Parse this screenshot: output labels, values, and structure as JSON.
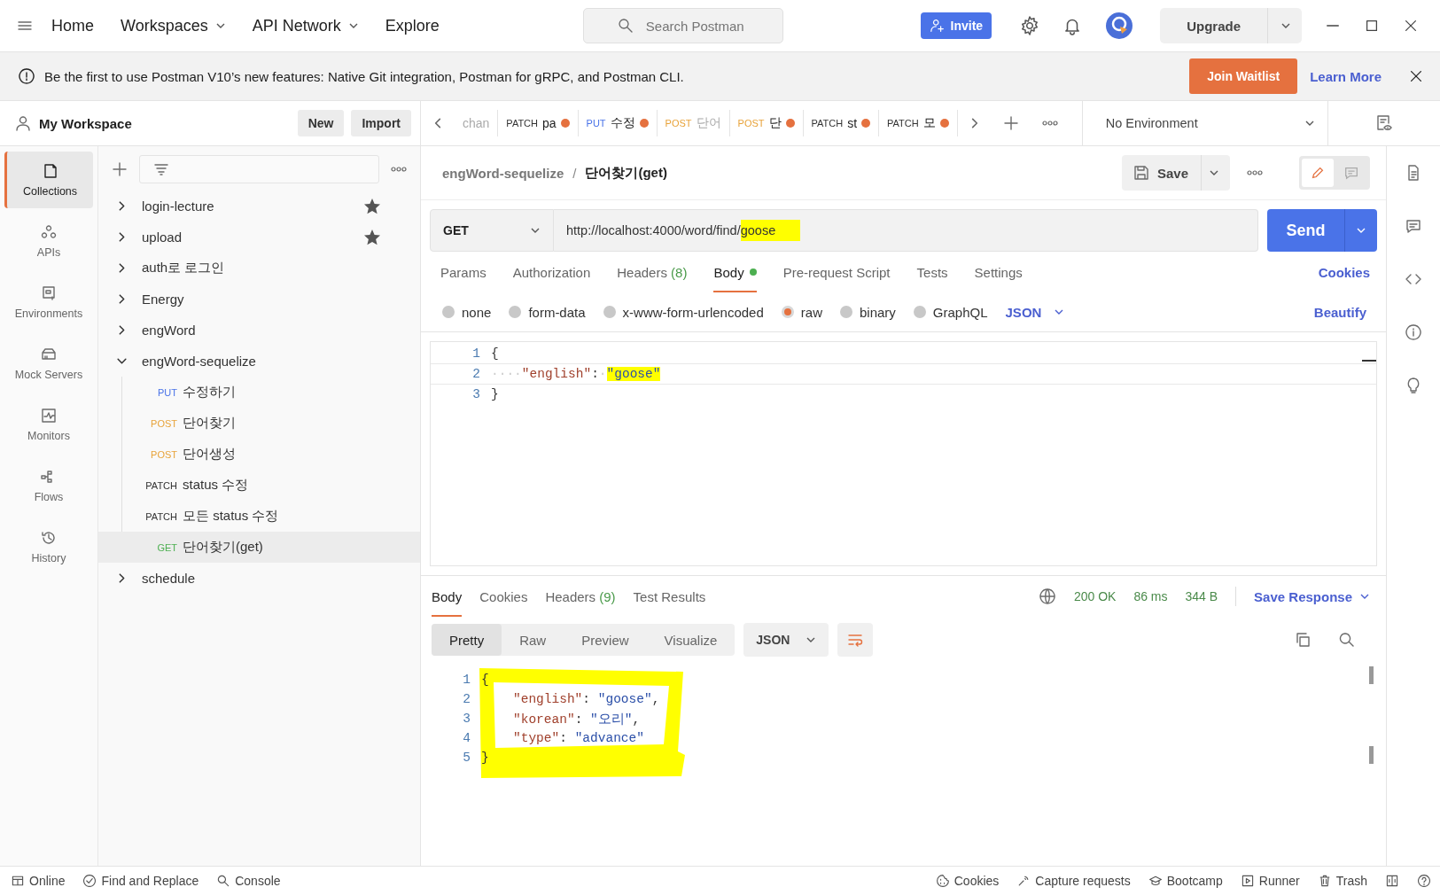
{
  "topbar": {
    "nav": [
      {
        "label": "Home",
        "dropdown": false
      },
      {
        "label": "Workspaces",
        "dropdown": true
      },
      {
        "label": "API Network",
        "dropdown": true
      },
      {
        "label": "Explore",
        "dropdown": false
      }
    ],
    "search": {
      "placeholder": "Search Postman"
    },
    "invite": "Invite",
    "upgrade": "Upgrade"
  },
  "banner": {
    "text": "Be the first to use Postman V10’s new features: Native Git integration, Postman for gRPC, and Postman CLI.",
    "join": "Join Waitlist",
    "learn": "Learn More"
  },
  "workspace": {
    "name": "My Workspace",
    "new": "New",
    "import": "Import"
  },
  "nav_rail": [
    {
      "label": "Collections",
      "selected": true
    },
    {
      "label": "APIs",
      "selected": false
    },
    {
      "label": "Environments",
      "selected": false
    },
    {
      "label": "Mock Servers",
      "selected": false
    },
    {
      "label": "Monitors",
      "selected": false
    },
    {
      "label": "Flows",
      "selected": false
    },
    {
      "label": "History",
      "selected": false
    }
  ],
  "collections": [
    {
      "name": "login-lecture",
      "starred": true,
      "expanded": false
    },
    {
      "name": "upload",
      "starred": true,
      "expanded": false
    },
    {
      "name": "auth로 로그인",
      "starred": false,
      "expanded": false
    },
    {
      "name": "Energy",
      "starred": false,
      "expanded": false
    },
    {
      "name": "engWord",
      "starred": false,
      "expanded": false
    },
    {
      "name": "engWord-sequelize",
      "starred": false,
      "expanded": true,
      "children": [
        {
          "method": "PUT",
          "color": "#4a73e8",
          "name": "수정하기",
          "selected": false
        },
        {
          "method": "POST",
          "color": "#e8a33a",
          "name": "단어찾기",
          "selected": false
        },
        {
          "method": "POST",
          "color": "#e8a33a",
          "name": "단어생성",
          "selected": false
        },
        {
          "method": "PATCH",
          "color": "#333333",
          "name": "status 수정",
          "selected": false
        },
        {
          "method": "PATCH",
          "color": "#333333",
          "name": "모든 status 수정",
          "selected": false
        },
        {
          "method": "GET",
          "color": "#4caf50",
          "name": "단어찾기(get)",
          "selected": true
        }
      ]
    },
    {
      "name": "schedule",
      "starred": false,
      "expanded": false
    }
  ],
  "request_tabs": [
    {
      "name": "chan",
      "faded": true,
      "unsaved": false
    },
    {
      "method": "PATCH",
      "color": "#333333",
      "name": "pa",
      "faded": false,
      "unsaved": true
    },
    {
      "method": "PUT",
      "color": "#4a73e8",
      "name": "수정",
      "faded": false,
      "unsaved": true
    },
    {
      "method": "POST",
      "color": "#e8a33a",
      "name": "단어",
      "faded": true,
      "unsaved": false
    },
    {
      "method": "POST",
      "color": "#e8a33a",
      "name": "단",
      "faded": false,
      "unsaved": true
    },
    {
      "method": "PATCH",
      "color": "#333333",
      "name": "st",
      "faded": false,
      "unsaved": true
    },
    {
      "method": "PATCH",
      "color": "#333333",
      "name": "모",
      "faded": false,
      "unsaved": true
    }
  ],
  "environment": "No Environment",
  "request": {
    "collection": "engWord-sequelize",
    "separator": "/",
    "name": "단어찾기(get)",
    "save": "Save",
    "method": "GET",
    "url": [
      {
        "text": "http://localhost:4000/word/find/",
        "highlighted": false
      },
      {
        "text": "goose",
        "highlighted": true
      }
    ],
    "send": "Send",
    "tabs": [
      {
        "label": "Params",
        "selected": false
      },
      {
        "label": "Authorization",
        "selected": false
      },
      {
        "label": "Headers",
        "count": "(8)",
        "selected": false
      },
      {
        "label": "Body",
        "dot": true,
        "selected": true
      },
      {
        "label": "Pre-request Script",
        "selected": false
      },
      {
        "label": "Tests",
        "selected": false
      },
      {
        "label": "Settings",
        "selected": false
      }
    ],
    "cookies": "Cookies",
    "body_types": [
      {
        "label": "none",
        "selected": false
      },
      {
        "label": "form-data",
        "selected": false
      },
      {
        "label": "x-www-form-urlencoded",
        "selected": false
      },
      {
        "label": "raw",
        "selected": true
      },
      {
        "label": "binary",
        "selected": false
      },
      {
        "label": "GraphQL",
        "selected": false
      }
    ],
    "format": "JSON",
    "beautify": "Beautify",
    "body": [
      {
        "n": "1",
        "tokens": [
          {
            "kind": "punct",
            "text": "{",
            "highlighted": false
          }
        ]
      },
      {
        "n": "2",
        "tokens": [
          {
            "kind": "ws",
            "text": "····",
            "highlighted": false
          },
          {
            "kind": "key",
            "text": "\"english\"",
            "highlighted": false
          },
          {
            "kind": "punct",
            "text": ":",
            "highlighted": false
          },
          {
            "kind": "ws",
            "text": "·",
            "highlighted": false
          },
          {
            "kind": "string",
            "text": "\"goose\"",
            "highlighted": true
          }
        ]
      },
      {
        "n": "3",
        "tokens": [
          {
            "kind": "punct",
            "text": "}",
            "highlighted": false
          }
        ]
      }
    ]
  },
  "response": {
    "tabs": [
      {
        "label": "Body",
        "selected": true
      },
      {
        "label": "Cookies",
        "selected": false
      },
      {
        "label": "Headers",
        "count": "(9)",
        "selected": false
      },
      {
        "label": "Test Results",
        "selected": false
      }
    ],
    "status": "200 OK",
    "time": "86 ms",
    "size": "344 B",
    "save": "Save Response",
    "views": [
      {
        "label": "Pretty",
        "selected": true
      },
      {
        "label": "Raw",
        "selected": false
      },
      {
        "label": "Preview",
        "selected": false
      },
      {
        "label": "Visualize",
        "selected": false
      }
    ],
    "format": "JSON",
    "body": [
      {
        "n": "1",
        "indent": false,
        "tokens": [
          {
            "kind": "punct",
            "text": "{"
          }
        ]
      },
      {
        "n": "2",
        "indent": true,
        "tokens": [
          {
            "kind": "key",
            "text": "\"english\""
          },
          {
            "kind": "punct",
            "text": ": "
          },
          {
            "kind": "string",
            "text": "\"goose\""
          },
          {
            "kind": "punct",
            "text": ","
          }
        ]
      },
      {
        "n": "3",
        "indent": true,
        "tokens": [
          {
            "kind": "key",
            "text": "\"korean\""
          },
          {
            "kind": "punct",
            "text": ": "
          },
          {
            "kind": "string",
            "text": "\"오리\""
          },
          {
            "kind": "punct",
            "text": ","
          }
        ]
      },
      {
        "n": "4",
        "indent": true,
        "tokens": [
          {
            "kind": "key",
            "text": "\"type\""
          },
          {
            "kind": "punct",
            "text": ": "
          },
          {
            "kind": "string",
            "text": "\"advance\""
          }
        ]
      },
      {
        "n": "5",
        "indent": false,
        "tokens": [
          {
            "kind": "punct",
            "text": "}"
          }
        ]
      }
    ]
  },
  "status_bar": {
    "left": [
      "Online",
      "Find and Replace",
      "Console"
    ],
    "right": [
      "Cookies",
      "Capture requests",
      "Bootcamp",
      "Runner",
      "Trash"
    ]
  }
}
